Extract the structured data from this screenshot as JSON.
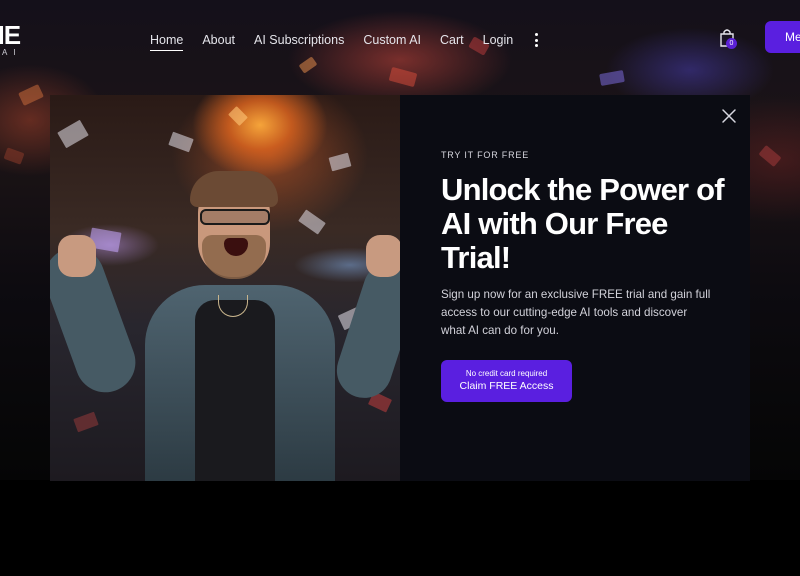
{
  "header": {
    "logo_text": "NE",
    "logo_sub": "AI",
    "nav": [
      {
        "label": "Home",
        "active": true
      },
      {
        "label": "About"
      },
      {
        "label": "AI Subscriptions"
      },
      {
        "label": "Custom AI"
      },
      {
        "label": "Cart"
      },
      {
        "label": "Login"
      }
    ],
    "more_icon": "kebab-menu-icon",
    "cart_icon": "shopping-bag-icon",
    "cart_count": "0",
    "header_button": "Me"
  },
  "modal": {
    "eyebrow": "TRY IT FOR FREE",
    "headline": "Unlock the Power of AI with Our Free Trial!",
    "body": "Sign up now for an exclusive FREE trial and gain full access to our cutting-edge AI tools and discover what AI can do for you.",
    "cta_sub": "No credit card required",
    "cta_main": "Claim FREE Access",
    "close_icon": "close-icon"
  },
  "colors": {
    "accent": "#5a1fe0",
    "modal_bg": "#0b0c13",
    "page_bg": "#000000"
  }
}
